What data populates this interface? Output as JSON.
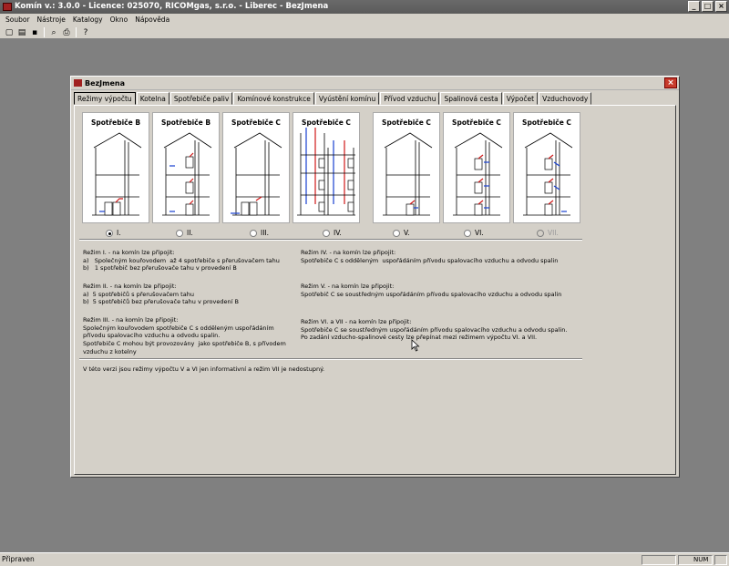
{
  "window": {
    "title": "Komín v.: 3.0.0 - Licence: 025070, RICOMgas, s.r.o. - Liberec - BezJmena",
    "min": "_",
    "max": "□",
    "close": "×"
  },
  "menu": [
    "Soubor",
    "Nástroje",
    "Katalogy",
    "Okno",
    "Nápověda"
  ],
  "toolbar": {
    "icons": [
      "new-icon",
      "open-icon",
      "save-icon",
      "print-preview-icon",
      "print-icon",
      "help-icon"
    ],
    "glyphs": [
      "▢",
      "▤",
      "▪",
      "⌕",
      "⎙",
      "?"
    ]
  },
  "dialog": {
    "title": "BezJmena",
    "close": "×",
    "tabs": [
      "Režimy výpočtu",
      "Kotelna",
      "Spotřebiče paliv",
      "Komínové konstrukce",
      "Vyústění komínu",
      "Přívod vzduchu",
      "Spalinová cesta",
      "Výpočet",
      "Vzduchovody"
    ],
    "active_tab": 0,
    "cards": [
      {
        "title": "Spotřebiče B",
        "label": "I.",
        "selected": true,
        "enabled": true
      },
      {
        "title": "Spotřebiče B",
        "label": "II.",
        "selected": false,
        "enabled": true
      },
      {
        "title": "Spotřebiče C",
        "label": "III.",
        "selected": false,
        "enabled": true
      },
      {
        "title": "Spotřebiče C",
        "label": "IV.",
        "selected": false,
        "enabled": true
      },
      {
        "title": "Spotřebiče C",
        "label": "V.",
        "selected": false,
        "enabled": true
      },
      {
        "title": "Spotřebiče C",
        "label": "VI.",
        "selected": false,
        "enabled": true
      },
      {
        "title": "Spotřebiče C",
        "label": "VII.",
        "selected": false,
        "enabled": false
      }
    ],
    "descriptions": {
      "mode1": "Režim I. - na komín lze připojit:\na)   Společným kouřovodem  až 4 spotřebiče s přerušovačem tahu\nb)   1 spotřebič bez přerušovače tahu v provedení B",
      "mode2": "Režim II. - na komín lze připojit:\na)  5 spotřebičů s přerušovačem tahu\nb)  5 spotřebičů bez přerušovače tahu v provedení B",
      "mode3": "Režim III. - na komín lze připojit:\nSpolečným kouřovodem spotřebiče C s odděleným uspořádáním\npřívodu spalovacího vzduchu a odvodu spalin.\nSpotřebiče C mohou být provozovány  jako spotřebiče B, s přívodem\nvzduchu z kotelny",
      "mode4": "Režim IV. - na komín lze připojit:\nSpotřebiče C s odděleným  uspořádáním přívodu spalovacího vzduchu a odvodu spalin",
      "mode5": "Režim V. - na komín lze připojit:\nSpotřebič C se soustředným uspořádáním přívodu spalovacího vzduchu a odvodu spalin",
      "mode67": "Režim VI. a VII - na komín lze připojit:\nSpotřebiče C se soustředným uspořádáním přívodu spalovacího vzduchu a odvodu spalin.\nPo zadání vzducho-spalinové cesty lze přepínat mezi režimem výpočtu VI. a VII.",
      "note": "V této verzi jsou režimy výpočtu V a VI jen informativní a režim VII je nedostupný."
    }
  },
  "status": {
    "text": "Připraven",
    "num": "NUM"
  },
  "colors": {
    "desktop": "#808080",
    "arrow_red": "#d01818",
    "arrow_blue": "#1840d0"
  }
}
